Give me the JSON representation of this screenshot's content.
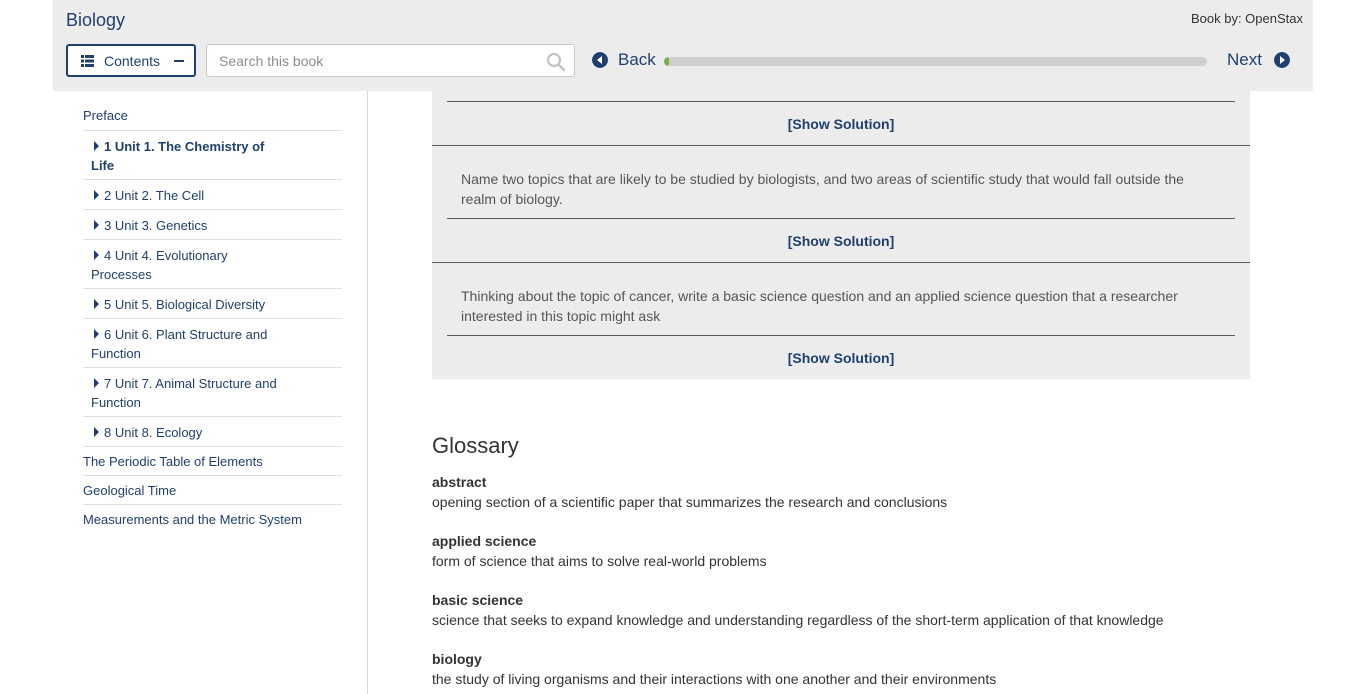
{
  "header": {
    "book_title": "Biology",
    "book_by": "Book by: OpenStax",
    "contents_label": "Contents",
    "search_placeholder": "Search this book",
    "back_label": "Back",
    "next_label": "Next",
    "progress_fraction": 0.01
  },
  "sidebar": {
    "top_items": [
      {
        "label": "Preface"
      }
    ],
    "units": [
      {
        "label": "1 Unit 1. The Chemistry of Life",
        "active": true
      },
      {
        "label": "2 Unit 2. The Cell"
      },
      {
        "label": "3 Unit 3. Genetics"
      },
      {
        "label": "4 Unit 4. Evolutionary Processes"
      },
      {
        "label": "5 Unit 5. Biological Diversity"
      },
      {
        "label": "6 Unit 6. Plant Structure and Function"
      },
      {
        "label": "7 Unit 7. Animal Structure and Function"
      },
      {
        "label": "8 Unit 8. Ecology"
      }
    ],
    "bottom_items": [
      {
        "label": "The Periodic Table of Elements"
      },
      {
        "label": "Geological Time"
      },
      {
        "label": "Measurements and the Metric System"
      }
    ]
  },
  "main": {
    "show_solution_label": "[Show Solution]",
    "problems": [
      {
        "text": "Name two topics that are likely to be studied by biologists, and two areas of scientific study that would fall outside the realm of biology."
      },
      {
        "text": "Thinking about the topic of cancer, write a basic science question and an applied science question that a researcher interested in this topic might ask"
      }
    ],
    "glossary": {
      "heading": "Glossary",
      "terms": [
        {
          "term": "abstract",
          "definition": "opening section of a scientific paper that summarizes the research and conclusions"
        },
        {
          "term": "applied science",
          "definition": "form of science that aims to solve real-world problems"
        },
        {
          "term": "basic science",
          "definition": "science that seeks to expand knowledge and understanding regardless of the short-term application of that knowledge"
        },
        {
          "term": "biology",
          "definition": "the study of living organisms and their interactions with one another and their environments"
        }
      ]
    }
  },
  "colors": {
    "brand": "#1f3f6e",
    "progress": "#78b04a",
    "header_bg": "#ececec"
  },
  "icons": [
    "list-icon",
    "minus-icon",
    "search-icon",
    "back-arrow-icon",
    "next-arrow-icon",
    "caret-right-icon"
  ]
}
